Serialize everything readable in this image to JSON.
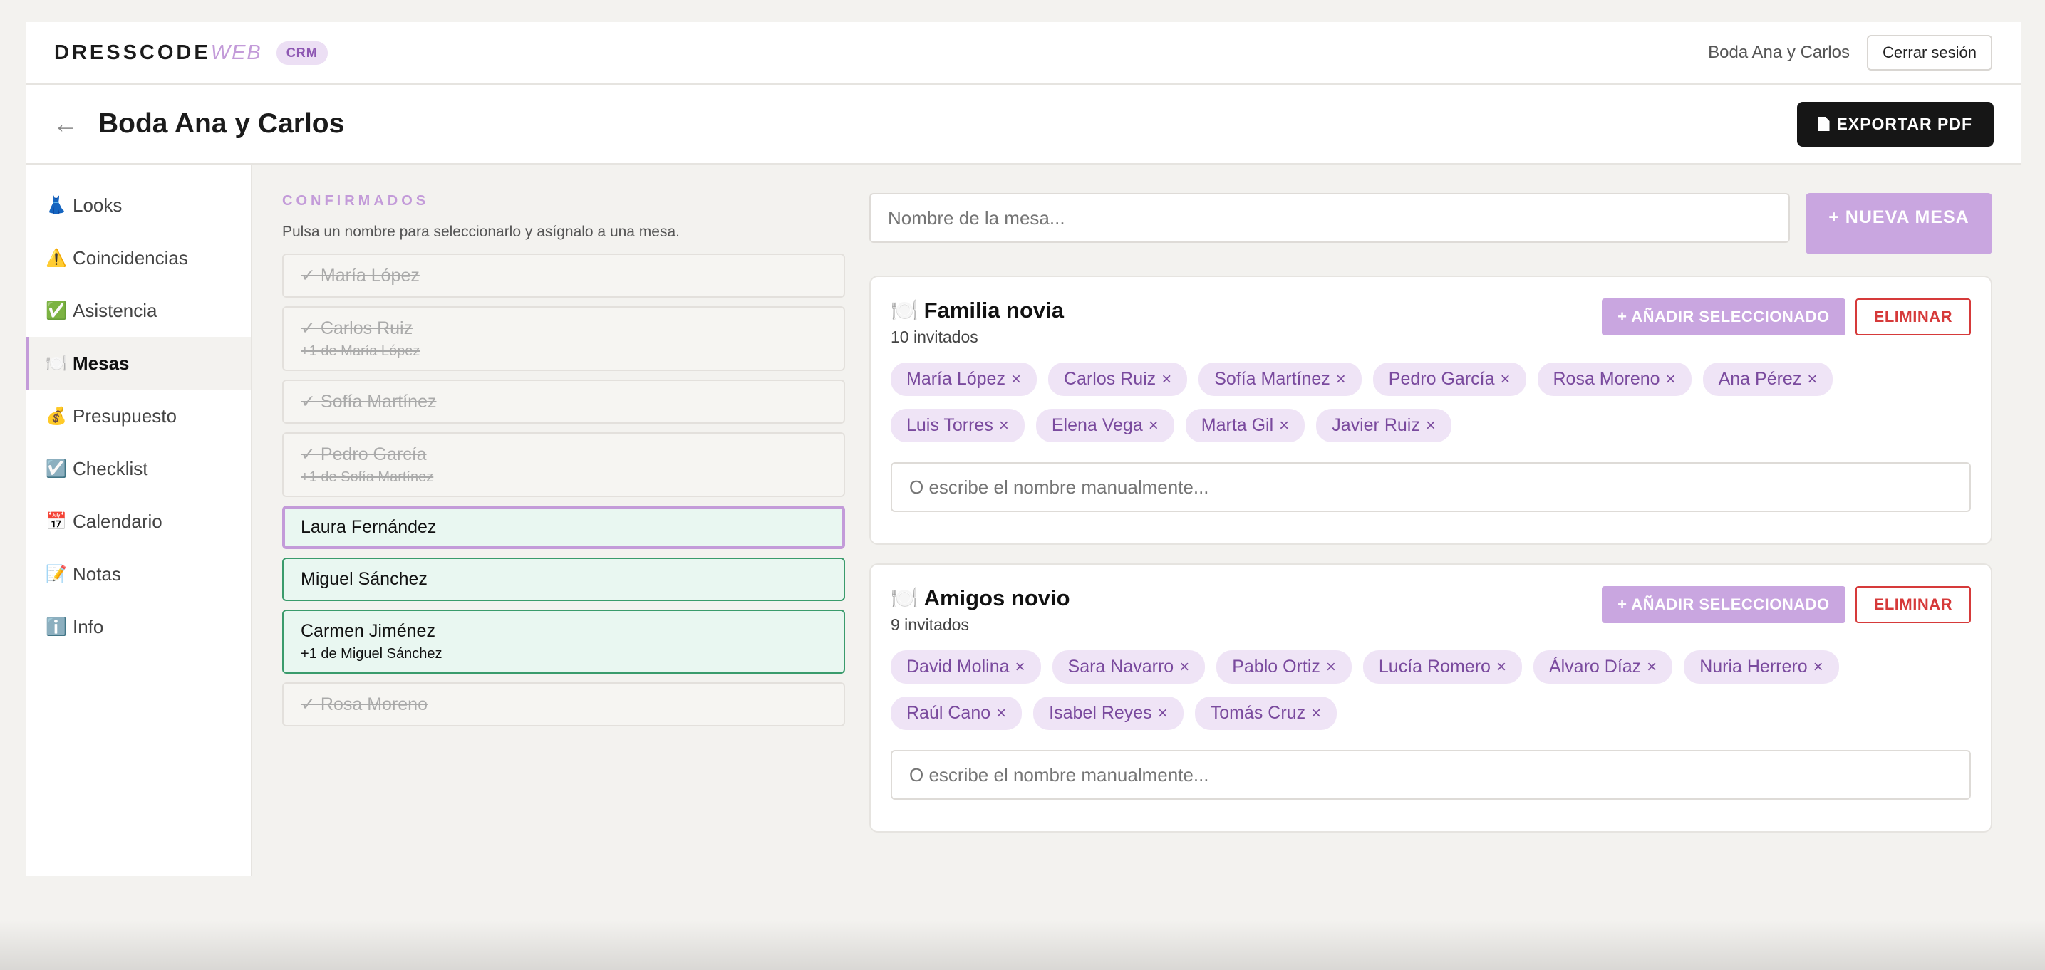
{
  "brand": {
    "name": "DRESSCODE",
    "suffix": "WEB",
    "badge": "CRM"
  },
  "header": {
    "event_name": "Boda Ana y Carlos",
    "logout_label": "Cerrar sesión"
  },
  "page": {
    "back_icon": "←",
    "title": "Boda Ana y Carlos",
    "export_label": "EXPORTAR PDF"
  },
  "sidebar": {
    "items": [
      {
        "emoji": "👗",
        "label": "Looks"
      },
      {
        "emoji": "⚠️",
        "label": "Coincidencias"
      },
      {
        "emoji": "✅",
        "label": "Asistencia"
      },
      {
        "emoji": "🍽️",
        "label": "Mesas",
        "active": true
      },
      {
        "emoji": "💰",
        "label": "Presupuesto"
      },
      {
        "emoji": "☑️",
        "label": "Checklist"
      },
      {
        "emoji": "📅",
        "label": "Calendario"
      },
      {
        "emoji": "📝",
        "label": "Notas"
      },
      {
        "emoji": "ℹ️",
        "label": "Info"
      }
    ]
  },
  "guests": {
    "section_label": "CONFIRMADOS",
    "hint": "Pulsa un nombre para seleccionarlo y asígnalo a una mesa.",
    "list": [
      {
        "name": "✓ María López",
        "state": "seated"
      },
      {
        "name": "✓ Carlos Ruiz",
        "sub": "+1 de María López",
        "state": "seated"
      },
      {
        "name": "✓ Sofía Martínez",
        "state": "seated"
      },
      {
        "name": "✓ Pedro García",
        "sub": "+1 de Sofía Martínez",
        "state": "seated"
      },
      {
        "name": "Laura Fernández",
        "state": "selected"
      },
      {
        "name": "Miguel Sánchez",
        "state": "pending"
      },
      {
        "name": "Carmen Jiménez",
        "sub": "+1 de Miguel Sánchez",
        "state": "pending"
      },
      {
        "name": "✓ Rosa Moreno",
        "state": "seated"
      }
    ]
  },
  "new_table": {
    "placeholder": "Nombre de la mesa...",
    "button_label": "+ NUEVA MESA"
  },
  "tables": [
    {
      "icon": "🍽️",
      "name": "Familia novia",
      "count": "10 invitados",
      "add_label": "+ AÑADIR SELECCIONADO",
      "delete_label": "ELIMINAR",
      "guests": [
        "María López",
        "Carlos Ruiz",
        "Sofía Martínez",
        "Pedro García",
        "Rosa Moreno",
        "Ana Pérez",
        "Luis Torres",
        "Elena Vega",
        "Marta Gil",
        "Javier Ruiz"
      ],
      "manual_placeholder": "O escribe el nombre manualmente..."
    },
    {
      "icon": "🍽️",
      "name": "Amigos novio",
      "count": "9 invitados",
      "add_label": "+ AÑADIR SELECCIONADO",
      "delete_label": "ELIMINAR",
      "guests": [
        "David Molina",
        "Sara Navarro",
        "Pablo Ortiz",
        "Lucía Romero",
        "Álvaro Díaz",
        "Nuria Herrero",
        "Raúl Cano",
        "Isabel Reyes",
        "Tomás Cruz"
      ],
      "manual_placeholder": "O escribe el nombre manualmente..."
    }
  ],
  "chip_remove_glyph": "×",
  "colors": {
    "accent": "#c39bd9",
    "danger": "#d63a3a",
    "pending_bg": "#e9f7f1",
    "pending_border": "#3a9b6c"
  }
}
